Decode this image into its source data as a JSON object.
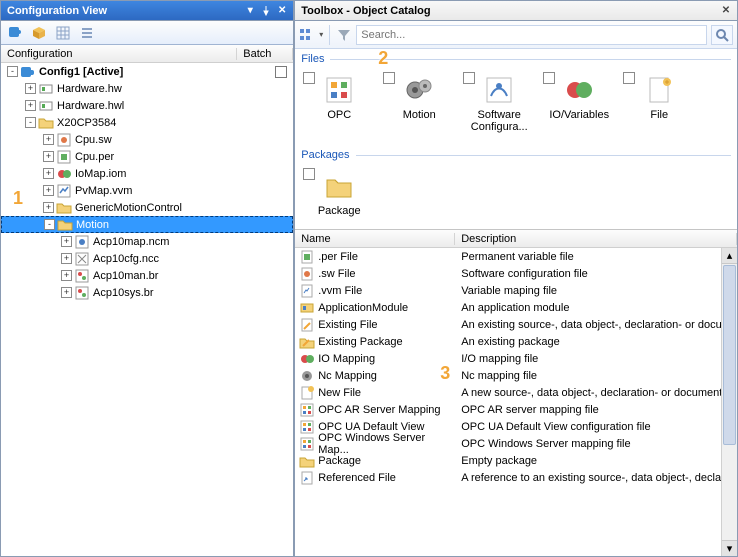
{
  "left": {
    "title": "Configuration View",
    "columns": {
      "c1": "Configuration",
      "c2": "Batch"
    },
    "tree": [
      {
        "depth": 0,
        "exp": "-",
        "label": "Config1 [Active]",
        "bold": true,
        "icon": "config-root-icon",
        "checkbox": true
      },
      {
        "depth": 1,
        "exp": "+",
        "label": "Hardware.hw",
        "icon": "hardware-icon"
      },
      {
        "depth": 1,
        "exp": "+",
        "label": "Hardware.hwl",
        "icon": "hardware-icon"
      },
      {
        "depth": 1,
        "exp": "-",
        "label": "X20CP3584",
        "icon": "cpu-folder-icon"
      },
      {
        "depth": 2,
        "exp": "+",
        "label": "Cpu.sw",
        "icon": "cpu-sw-icon"
      },
      {
        "depth": 2,
        "exp": "+",
        "label": "Cpu.per",
        "icon": "cpu-per-icon"
      },
      {
        "depth": 2,
        "exp": "+",
        "label": "IoMap.iom",
        "icon": "iomap-icon"
      },
      {
        "depth": 2,
        "exp": "+",
        "label": "PvMap.vvm",
        "icon": "pvmap-icon"
      },
      {
        "depth": 2,
        "exp": "+",
        "label": "GenericMotionControl",
        "icon": "folder-icon"
      },
      {
        "depth": 2,
        "exp": "-",
        "label": "Motion",
        "icon": "folder-icon",
        "selected": true
      },
      {
        "depth": 3,
        "exp": "+",
        "label": "Acp10map.ncm",
        "icon": "ncm-icon"
      },
      {
        "depth": 3,
        "exp": "+",
        "label": "Acp10cfg.ncc",
        "icon": "ncc-icon"
      },
      {
        "depth": 3,
        "exp": "+",
        "label": "Acp10man.br",
        "icon": "br-icon"
      },
      {
        "depth": 3,
        "exp": "+",
        "label": "Acp10sys.br",
        "icon": "br-icon"
      }
    ]
  },
  "right": {
    "title": "Toolbox - Object Catalog",
    "search_placeholder": "Search...",
    "sections": {
      "files": {
        "label": "Files",
        "items": [
          {
            "label": "OPC",
            "icon": "opc-icon"
          },
          {
            "label": "Motion",
            "icon": "motion-icon"
          },
          {
            "label": "Software Configura...",
            "icon": "software-config-icon"
          },
          {
            "label": "IO/Variables",
            "icon": "io-variables-icon"
          },
          {
            "label": "File",
            "icon": "new-file-icon"
          }
        ]
      },
      "packages": {
        "label": "Packages",
        "items": [
          {
            "label": "Package",
            "icon": "package-folder-icon"
          }
        ]
      }
    },
    "list_columns": {
      "name": "Name",
      "desc": "Description"
    },
    "list": [
      {
        "name": ".per File",
        "desc": "Permanent variable file",
        "icon": "per-file-icon"
      },
      {
        "name": ".sw File",
        "desc": "Software configuration file",
        "icon": "sw-file-icon"
      },
      {
        "name": ".vvm File",
        "desc": "Variable maping file",
        "icon": "vvm-file-icon"
      },
      {
        "name": "ApplicationModule",
        "desc": "An application module",
        "icon": "app-module-icon"
      },
      {
        "name": "Existing File",
        "desc": "An existing source-, data object-, declaration- or docume",
        "icon": "existing-file-icon"
      },
      {
        "name": "Existing Package",
        "desc": "An existing package",
        "icon": "existing-package-icon"
      },
      {
        "name": "IO Mapping",
        "desc": "I/O mapping file",
        "icon": "io-mapping-icon"
      },
      {
        "name": "Nc Mapping",
        "desc": "Nc mapping file",
        "icon": "nc-mapping-icon"
      },
      {
        "name": "New File",
        "desc": "A new source-, data object-, declaration- or documentat",
        "icon": "new-file-small-icon"
      },
      {
        "name": "OPC AR Server Mapping",
        "desc": "OPC AR server mapping file",
        "icon": "opc-ar-icon"
      },
      {
        "name": "OPC UA Default View",
        "desc": "OPC UA Default View configuration file",
        "icon": "opc-ua-icon"
      },
      {
        "name": "OPC Windows Server Map...",
        "desc": "OPC Windows Server mapping file",
        "icon": "opc-win-icon"
      },
      {
        "name": "Package",
        "desc": "Empty package",
        "icon": "package-small-icon"
      },
      {
        "name": "Referenced File",
        "desc": "A reference to an existing source-, data object-, declara",
        "icon": "ref-file-icon"
      }
    ]
  },
  "annotations": {
    "a1": "1",
    "a2": "2",
    "a3": "3"
  }
}
